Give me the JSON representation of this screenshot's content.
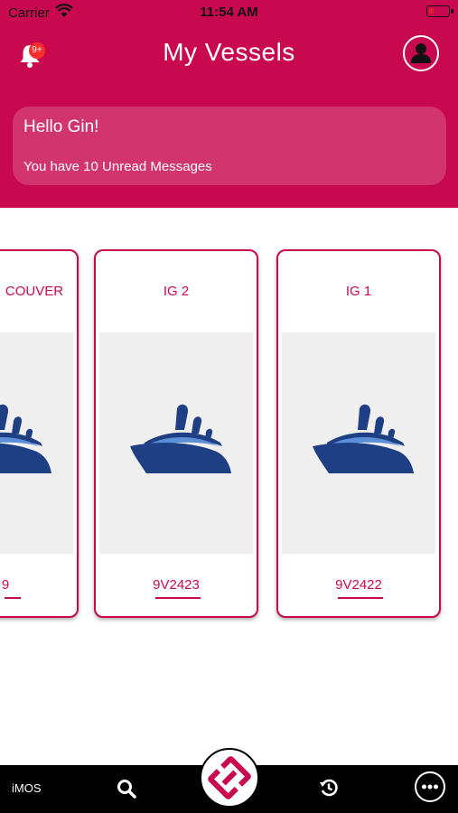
{
  "status_bar": {
    "carrier": "Carrier",
    "time": "11:54 AM"
  },
  "header": {
    "title": "My Vessels",
    "notification_badge": "9+",
    "welcome": {
      "greeting": "Hello Gin!",
      "unread_text": "You have 10 Unread Messages"
    }
  },
  "vessels": [
    {
      "name": "COUVER",
      "code": "9"
    },
    {
      "name": "IG 2",
      "code": "9V2423"
    },
    {
      "name": "IG 1",
      "code": "9V2422"
    }
  ],
  "tabbar": {
    "app_label": "iMOS"
  },
  "colors": {
    "brand": "#c8084f",
    "ship_dark": "#1e3f84",
    "ship_light": "#5b8fd6"
  }
}
